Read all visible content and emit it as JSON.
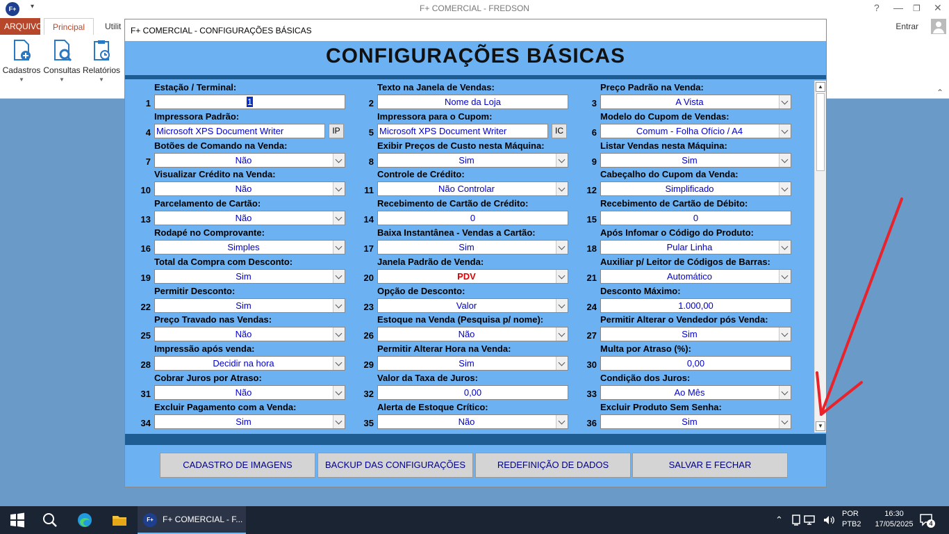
{
  "app": {
    "logo_text": "F+",
    "title": "F+ COMERCIAL - FREDSON",
    "sign_in": "Entrar"
  },
  "ribbon": {
    "tabs": [
      "ARQUIVO",
      "Principal",
      "Utilit"
    ],
    "buttons": [
      "Cadastros",
      "Consultas",
      "Relatórios"
    ]
  },
  "dialog": {
    "window_title": "F+ COMERCIAL - CONFIGURAÇÕES BÁSICAS",
    "heading": "CONFIGURAÇÕES BÁSICAS",
    "fields": [
      {
        "num": "1",
        "label": "Estação / Terminal:",
        "value": "1",
        "type": "text"
      },
      {
        "num": "2",
        "label": "Texto na Janela de Vendas:",
        "value": "Nome da Loja",
        "type": "text"
      },
      {
        "num": "3",
        "label": "Preço Padrão na Venda:",
        "value": "A Vista",
        "type": "dropdown"
      },
      {
        "num": "4",
        "label": "Impressora Padrão:",
        "value": "Microsoft XPS Document Writer",
        "type": "printer",
        "button": "IP"
      },
      {
        "num": "5",
        "label": "Impressora para o Cupom:",
        "value": "Microsoft XPS Document Writer",
        "type": "printer",
        "button": "IC"
      },
      {
        "num": "6",
        "label": "Modelo do Cupom de Vendas:",
        "value": "Comum - Folha Ofício / A4",
        "type": "dropdown"
      },
      {
        "num": "7",
        "label": "Botões de Comando na Venda:",
        "value": "Não",
        "type": "dropdown"
      },
      {
        "num": "8",
        "label": "Exibir Preços de Custo nesta Máquina:",
        "value": "Sim",
        "type": "dropdown"
      },
      {
        "num": "9",
        "label": "Listar Vendas nesta Máquina:",
        "value": "Sim",
        "type": "dropdown"
      },
      {
        "num": "10",
        "label": "Visualizar Crédito na Venda:",
        "value": "Não",
        "type": "dropdown"
      },
      {
        "num": "11",
        "label": "Controle de Crédito:",
        "value": "Não Controlar",
        "type": "dropdown"
      },
      {
        "num": "12",
        "label": "Cabeçalho do Cupom da Venda:",
        "value": "Simplificado",
        "type": "dropdown"
      },
      {
        "num": "13",
        "label": "Parcelamento de Cartão:",
        "value": "Não",
        "type": "dropdown"
      },
      {
        "num": "14",
        "label": "Recebimento de Cartão de Crédito:",
        "value": "0",
        "type": "text"
      },
      {
        "num": "15",
        "label": "Recebimento de Cartão de Débito:",
        "value": "0",
        "type": "text"
      },
      {
        "num": "16",
        "label": "Rodapé no Comprovante:",
        "value": "Simples",
        "type": "dropdown"
      },
      {
        "num": "17",
        "label": "Baixa Instantânea - Vendas a Cartão:",
        "value": "Sim",
        "type": "dropdown"
      },
      {
        "num": "18",
        "label": "Após Infomar o Código do Produto:",
        "value": "Pular Linha",
        "type": "dropdown"
      },
      {
        "num": "19",
        "label": "Total da Compra com Desconto:",
        "value": "Sim",
        "type": "dropdown"
      },
      {
        "num": "20",
        "label": "Janela Padrão de Venda:",
        "value": "PDV",
        "type": "dropdown",
        "highlight": true
      },
      {
        "num": "21",
        "label": "Auxiliar p/ Leitor de Códigos de Barras:",
        "value": "Automático",
        "type": "dropdown"
      },
      {
        "num": "22",
        "label": "Permitir Desconto:",
        "value": "Sim",
        "type": "dropdown"
      },
      {
        "num": "23",
        "label": "Opção de Desconto:",
        "value": "Valor",
        "type": "dropdown"
      },
      {
        "num": "24",
        "label": "Desconto Máximo:",
        "value": "1.000,00",
        "type": "text"
      },
      {
        "num": "25",
        "label": "Preço Travado nas Vendas:",
        "value": "Não",
        "type": "dropdown"
      },
      {
        "num": "26",
        "label": "Estoque na Venda (Pesquisa p/ nome):",
        "value": "Não",
        "type": "dropdown"
      },
      {
        "num": "27",
        "label": "Permitir Alterar o Vendedor pós Venda:",
        "value": "Sim",
        "type": "dropdown"
      },
      {
        "num": "28",
        "label": "Impressão após venda:",
        "value": "Decidir na hora",
        "type": "dropdown"
      },
      {
        "num": "29",
        "label": "Permitir Alterar Hora na Venda:",
        "value": "Sim",
        "type": "dropdown"
      },
      {
        "num": "30",
        "label": "Multa por Atraso (%):",
        "value": "0,00",
        "type": "text"
      },
      {
        "num": "31",
        "label": "Cobrar Juros por Atraso:",
        "value": "Não",
        "type": "dropdown"
      },
      {
        "num": "32",
        "label": "Valor da Taxa de Juros:",
        "value": "0,00",
        "type": "text"
      },
      {
        "num": "33",
        "label": "Condição dos Juros:",
        "value": "Ao Mês",
        "type": "dropdown"
      },
      {
        "num": "34",
        "label": "Excluir Pagamento com a Venda:",
        "value": "Sim",
        "type": "dropdown"
      },
      {
        "num": "35",
        "label": "Alerta de Estoque Crítico:",
        "value": "Não",
        "type": "dropdown"
      },
      {
        "num": "36",
        "label": "Excluir Produto Sem Senha:",
        "value": "Sim",
        "type": "dropdown"
      }
    ],
    "buttons": [
      "CADASTRO DE IMAGENS",
      "BACKUP DAS CONFIGURAÇÕES",
      "REDEFINIÇÃO DE DADOS",
      "SALVAR E FECHAR"
    ]
  },
  "taskbar": {
    "app_label": "F+ COMERCIAL - F...",
    "language": "POR",
    "keyboard": "PTB2",
    "time": "16:30",
    "date": "17/05/2025",
    "notifications": "4"
  },
  "colors": {
    "dialog_bg": "#6cb2f3",
    "band": "#1e5d93",
    "value_text": "#0000cc",
    "highlight_value": "#e00000",
    "button_text": "#00008b",
    "annotation_arrow": "#e8232b"
  }
}
